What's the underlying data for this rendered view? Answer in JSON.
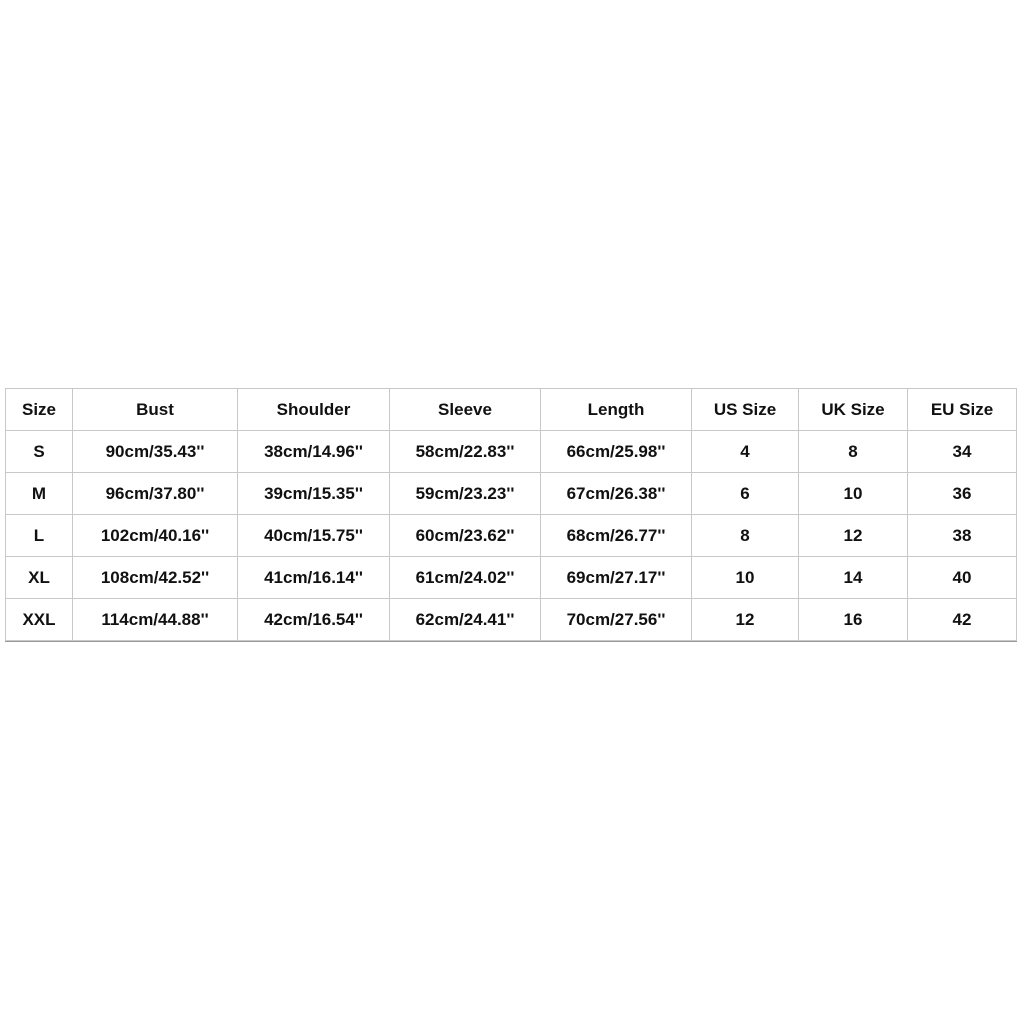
{
  "size_chart": {
    "headers": [
      "Size",
      "Bust",
      "Shoulder",
      "Sleeve",
      "Length",
      "US Size",
      "UK Size",
      "EU Size"
    ],
    "rows": [
      [
        "S",
        "90cm/35.43''",
        "38cm/14.96''",
        "58cm/22.83''",
        "66cm/25.98''",
        "4",
        "8",
        "34"
      ],
      [
        "M",
        "96cm/37.80''",
        "39cm/15.35''",
        "59cm/23.23''",
        "67cm/26.38''",
        "6",
        "10",
        "36"
      ],
      [
        "L",
        "102cm/40.16''",
        "40cm/15.75''",
        "60cm/23.62''",
        "68cm/26.77''",
        "8",
        "12",
        "38"
      ],
      [
        "XL",
        "108cm/42.52''",
        "41cm/16.14''",
        "61cm/24.02''",
        "69cm/27.17''",
        "10",
        "14",
        "40"
      ],
      [
        "XXL",
        "114cm/44.88''",
        "42cm/16.54''",
        "62cm/24.41''",
        "70cm/27.56''",
        "12",
        "16",
        "42"
      ]
    ]
  }
}
